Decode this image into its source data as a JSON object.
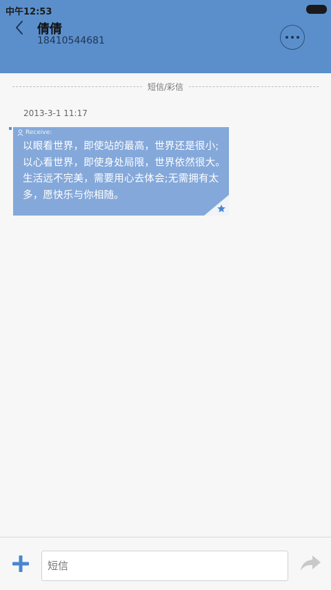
{
  "status_bar": {
    "time": "中午12:53"
  },
  "header": {
    "contact_name": "倩倩",
    "contact_number": "18410544681"
  },
  "conversation": {
    "divider_label": "短信/彩信",
    "messages": [
      {
        "timestamp": "2013-3-1 11:17",
        "direction_label": "Receive:",
        "text": "以眼看世界，即使站的最高，世界还是很小;以心看世界，即使身处局限，世界依然很大。生活远不完美，需要用心去体会;无需拥有太多，愿快乐与你相随。",
        "starred": true
      }
    ]
  },
  "composer": {
    "placeholder": "短信"
  },
  "colors": {
    "header_bg": "#5b8fcc",
    "bubble_bg": "#84a8da",
    "accent": "#4a86d0"
  }
}
